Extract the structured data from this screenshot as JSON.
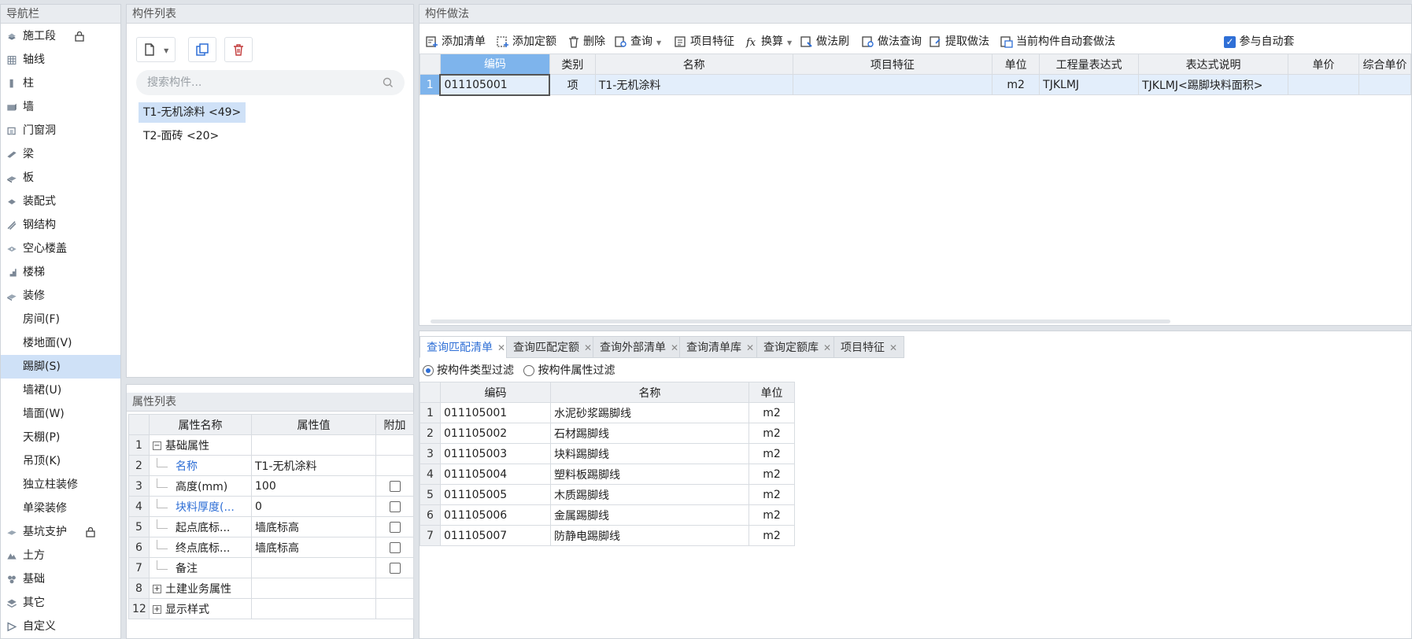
{
  "nav": {
    "title": "导航栏",
    "items": [
      {
        "label": "施工段",
        "icon": "construction-section-icon",
        "locked": true
      },
      {
        "label": "轴线",
        "icon": "axis-grid-icon"
      },
      {
        "label": "柱",
        "icon": "column-icon"
      },
      {
        "label": "墙",
        "icon": "wall-icon"
      },
      {
        "label": "门窗洞",
        "icon": "door-window-icon"
      },
      {
        "label": "梁",
        "icon": "beam-icon"
      },
      {
        "label": "板",
        "icon": "slab-icon"
      },
      {
        "label": "装配式",
        "icon": "prefab-icon"
      },
      {
        "label": "钢结构",
        "icon": "steel-structure-icon"
      },
      {
        "label": "空心楼盖",
        "icon": "hollow-floor-icon"
      },
      {
        "label": "楼梯",
        "icon": "stair-icon"
      },
      {
        "label": "装修",
        "icon": "decoration-icon"
      },
      {
        "label": "房间(F)",
        "sub": true
      },
      {
        "label": "楼地面(V)",
        "sub": true
      },
      {
        "label": "踢脚(S)",
        "sub": true,
        "active": true
      },
      {
        "label": "墙裙(U)",
        "sub": true
      },
      {
        "label": "墙面(W)",
        "sub": true
      },
      {
        "label": "天棚(P)",
        "sub": true
      },
      {
        "label": "吊顶(K)",
        "sub": true
      },
      {
        "label": "独立柱装修",
        "sub": true
      },
      {
        "label": "单梁装修",
        "sub": true
      },
      {
        "label": "基坑支护",
        "icon": "pit-support-icon",
        "locked": true
      },
      {
        "label": "土方",
        "icon": "earthwork-icon"
      },
      {
        "label": "基础",
        "icon": "foundation-icon"
      },
      {
        "label": "其它",
        "icon": "other-icon"
      },
      {
        "label": "自定义",
        "icon": "custom-icon"
      }
    ]
  },
  "components": {
    "title": "构件列表",
    "search_placeholder": "搜索构件...",
    "items": [
      {
        "label": "T1-无机涂料 <49>",
        "selected": true
      },
      {
        "label": "T2-面砖 <20>"
      }
    ]
  },
  "props": {
    "title": "属性列表",
    "headers": [
      "属性名称",
      "属性值",
      "附加"
    ],
    "rows": [
      {
        "n": "1",
        "name": "基础属性",
        "value": "",
        "check": false,
        "group": "minus"
      },
      {
        "n": "2",
        "name": "名称",
        "value": "T1-无机涂料",
        "check": false,
        "blue": true
      },
      {
        "n": "3",
        "name": "高度(mm)",
        "value": "100",
        "check": true
      },
      {
        "n": "4",
        "name": "块料厚度(...",
        "value": "0",
        "check": true,
        "blue": true
      },
      {
        "n": "5",
        "name": "起点底标...",
        "value": "墙底标高",
        "check": true
      },
      {
        "n": "6",
        "name": "终点底标...",
        "value": "墙底标高",
        "check": true
      },
      {
        "n": "7",
        "name": "备注",
        "value": "",
        "check": true
      },
      {
        "n": "8",
        "name": "土建业务属性",
        "value": "",
        "check": false,
        "group": "plus"
      },
      {
        "n": "12",
        "name": "显示样式",
        "value": "",
        "check": false,
        "group": "plus"
      }
    ]
  },
  "method": {
    "title": "构件做法",
    "toolbar": [
      {
        "label": "添加清单",
        "icon": "add-list-icon"
      },
      {
        "label": "添加定额",
        "icon": "add-quota-icon"
      },
      {
        "label": "删除",
        "icon": "delete-icon"
      },
      {
        "label": "查询",
        "icon": "query-icon",
        "dropdown": true
      },
      {
        "label": "项目特征",
        "icon": "project-feature-icon"
      },
      {
        "label": "换算",
        "icon": "fx-icon",
        "dropdown": true
      },
      {
        "label": "做法刷",
        "icon": "method-brush-icon"
      },
      {
        "label": "做法查询",
        "icon": "method-query-icon"
      },
      {
        "label": "提取做法",
        "icon": "extract-method-icon"
      },
      {
        "label": "当前构件自动套做法",
        "icon": "auto-apply-icon"
      }
    ],
    "auto_checkbox": "参与自动套",
    "headers": [
      "编码",
      "类别",
      "名称",
      "项目特征",
      "单位",
      "工程量表达式",
      "表达式说明",
      "单价",
      "综合单价"
    ],
    "rows": [
      {
        "n": "1",
        "code": "011105001",
        "type": "项",
        "name": "T1-无机涂料",
        "feature": "",
        "unit": "m2",
        "expr": "TJKLMJ",
        "desc": "TJKLMJ<踢脚块料面积>",
        "price": "",
        "total": ""
      }
    ]
  },
  "query": {
    "tabs": [
      "查询匹配清单",
      "查询匹配定额",
      "查询外部清单",
      "查询清单库",
      "查询定额库",
      "项目特征"
    ],
    "filter_type": "按构件类型过滤",
    "filter_attr": "按构件属性过滤",
    "headers": [
      "编码",
      "名称",
      "单位"
    ],
    "rows": [
      {
        "n": "1",
        "code": "011105001",
        "name": "水泥砂浆踢脚线",
        "unit": "m2"
      },
      {
        "n": "2",
        "code": "011105002",
        "name": "石材踢脚线",
        "unit": "m2"
      },
      {
        "n": "3",
        "code": "011105003",
        "name": "块料踢脚线",
        "unit": "m2"
      },
      {
        "n": "4",
        "code": "011105004",
        "name": "塑料板踢脚线",
        "unit": "m2"
      },
      {
        "n": "5",
        "code": "011105005",
        "name": "木质踢脚线",
        "unit": "m2"
      },
      {
        "n": "6",
        "code": "011105006",
        "name": "金属踢脚线",
        "unit": "m2"
      },
      {
        "n": "7",
        "code": "011105007",
        "name": "防静电踢脚线",
        "unit": "m2"
      }
    ]
  },
  "colors": {
    "accent": "#2f6fd6",
    "selection": "#cfe1f7",
    "header_highlight": "#7eb4ec"
  }
}
